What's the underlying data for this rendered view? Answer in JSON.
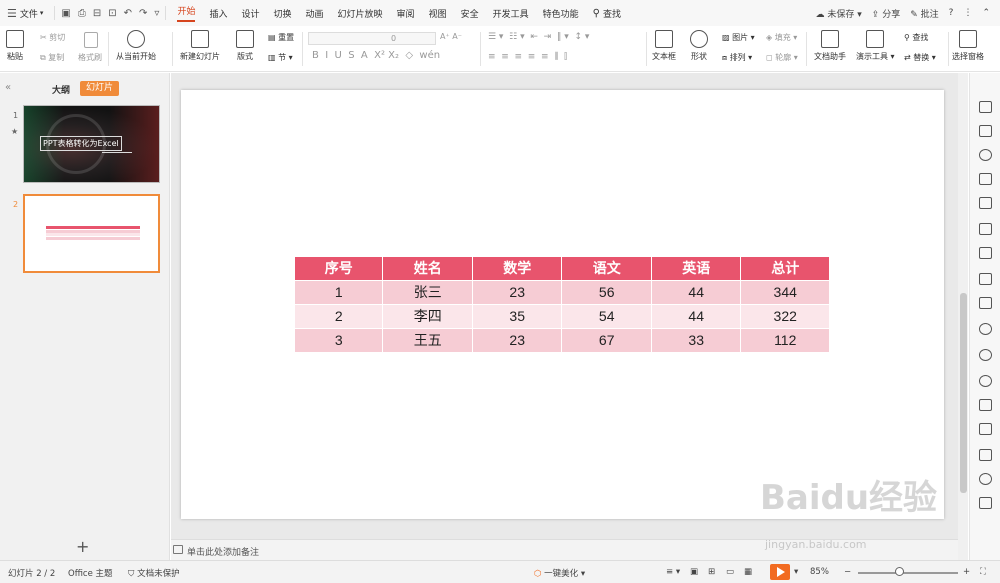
{
  "menu": {
    "file_label": "文件",
    "tabs": [
      "开始",
      "插入",
      "设计",
      "切换",
      "动画",
      "幻灯片放映",
      "审阅",
      "视图",
      "安全",
      "开发工具",
      "特色功能"
    ],
    "active_tab": "开始",
    "search_label": "查找",
    "unsaved_label": "未保存",
    "share_label": "分享",
    "comment_label": "批注",
    "help": "?"
  },
  "ribbon": {
    "paste": "粘贴",
    "cut": "剪切",
    "copy": "复制",
    "format_painter": "格式刷",
    "play_from_current": "从当前开始",
    "new_slide": "新建幻灯片",
    "layout": "版式",
    "section": "节",
    "reset": "重置",
    "font_size": "0",
    "text_box": "文本框",
    "shape": "形状",
    "picture": "图片",
    "arrange": "排列",
    "fill": "填充",
    "outline": "轮廓",
    "doc_assistant": "文档助手",
    "presentation_tools": "演示工具",
    "find": "查找",
    "replace": "替换",
    "selection_pane": "选择窗格"
  },
  "left_panel": {
    "tab_outline": "大纲",
    "tab_slides": "幻灯片",
    "slide1_num": "1",
    "slide2_num": "2",
    "slide1_title": "PPT表格转化为Excel"
  },
  "table": {
    "headers": [
      "序号",
      "姓名",
      "数学",
      "语文",
      "英语",
      "总计"
    ],
    "rows": [
      [
        "1",
        "张三",
        "23",
        "56",
        "44",
        "344"
      ],
      [
        "2",
        "李四",
        "35",
        "54",
        "44",
        "322"
      ],
      [
        "3",
        "王五",
        "23",
        "67",
        "33",
        "112"
      ]
    ]
  },
  "notes_placeholder": "单击此处添加备注",
  "status": {
    "slide_counter": "幻灯片 2 / 2",
    "theme": "Office 主题",
    "protection": "文档未保护",
    "beautify": "一键美化",
    "zoom": "85%"
  },
  "watermark": {
    "main": "Baidu经验",
    "sub": "jingyan.baidu.com"
  },
  "colors": {
    "accent": "#d6451e",
    "header_row": "#e8546d",
    "row_odd": "#f6ccd4",
    "row_even": "#fbe6ea",
    "slides_tab": "#f08b3a"
  }
}
